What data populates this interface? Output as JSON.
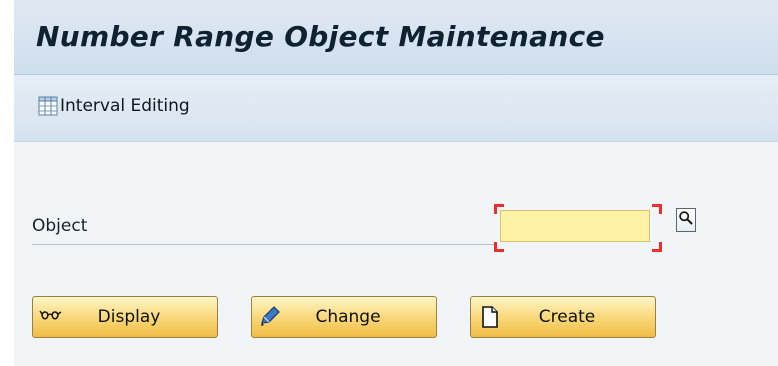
{
  "title_bar": {
    "title": "Number Range Object Maintenance"
  },
  "toolbar": {
    "interval_editing_label": "Interval Editing",
    "interval_editing_icon": "table-grid-icon"
  },
  "form": {
    "object_label": "Object",
    "object_value": "",
    "required_marker_color": "#ef2d2d",
    "input_background": "#fff2a6",
    "search_help_icon": "search-icon"
  },
  "actions": {
    "display_label": "Display",
    "display_icon": "glasses-icon",
    "change_label": "Change",
    "change_icon": "pencil-icon",
    "create_label": "Create",
    "create_icon": "document-icon"
  },
  "colors": {
    "button_top": "#fff6c7",
    "button_bottom": "#f0bd45",
    "title_bar": "#dfe9f3"
  }
}
